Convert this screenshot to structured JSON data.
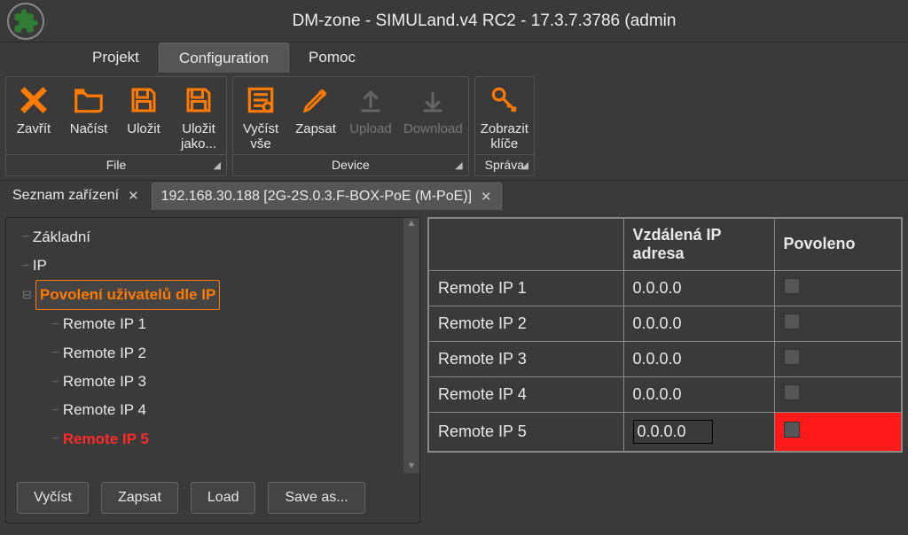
{
  "title": "DM-zone - SIMULand.v4 RC2 - 17.3.7.3786 (admin",
  "menu": {
    "projekt": "Projekt",
    "configuration": "Configuration",
    "pomoc": "Pomoc"
  },
  "ribbon": {
    "file": {
      "footer": "File",
      "zavrit": "Zavřít",
      "nacist": "Načíst",
      "ulozit": "Uložit",
      "ulozit_jako": "Uložit\njako..."
    },
    "device": {
      "footer": "Device",
      "vycist_vse": "Vyčíst\nvše",
      "zapsat": "Zapsat",
      "upload": "Upload",
      "download": "Download"
    },
    "sprava": {
      "footer": "Správa",
      "zobrazit_klice": "Zobrazit\nklíče"
    }
  },
  "doctabs": {
    "tab1": "Seznam zařízení",
    "tab2": "192.168.30.188 [2G-2S.0.3.F-BOX-PoE (M-PoE)]"
  },
  "tree": {
    "zakladni": "Základní",
    "ip": "IP",
    "povoleni": "Povolení uživatelů dle IP",
    "r1": "Remote IP 1",
    "r2": "Remote IP 2",
    "r3": "Remote IP 3",
    "r4": "Remote IP 4",
    "r5": "Remote IP 5"
  },
  "left_buttons": {
    "vycist": "Vyčíst",
    "zapsat": "Zapsat",
    "load": "Load",
    "save_as": "Save as..."
  },
  "table": {
    "col_name": "",
    "col_ip": "Vzdálená IP adresa",
    "col_enabled": "Povoleno",
    "rows": [
      {
        "name": "Remote IP 1",
        "ip": "0.0.0.0",
        "editing": false,
        "highlight": false
      },
      {
        "name": "Remote IP 2",
        "ip": "0.0.0.0",
        "editing": false,
        "highlight": false
      },
      {
        "name": "Remote IP 3",
        "ip": "0.0.0.0",
        "editing": false,
        "highlight": false
      },
      {
        "name": "Remote IP 4",
        "ip": "0.0.0.0",
        "editing": false,
        "highlight": false
      },
      {
        "name": "Remote IP 5",
        "ip": "0.0.0.0",
        "editing": true,
        "highlight": true
      }
    ]
  }
}
